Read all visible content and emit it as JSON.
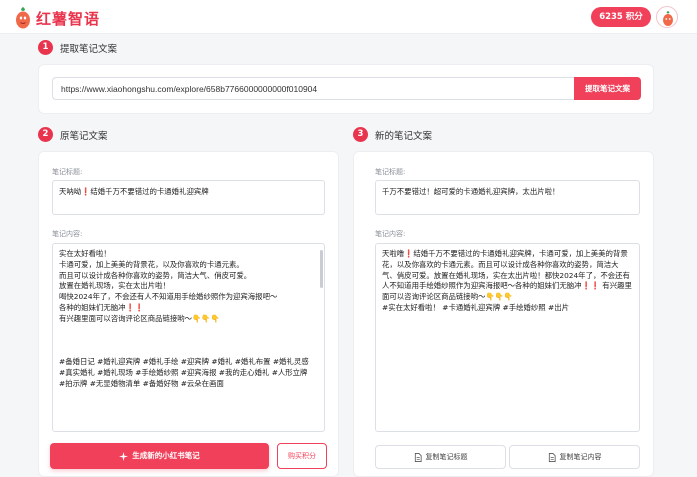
{
  "brand": {
    "name": "红薯智语"
  },
  "header": {
    "points_label": "6235 积分"
  },
  "steps": {
    "s1": {
      "num": "1",
      "label": "提取笔记文案"
    },
    "s2": {
      "num": "2",
      "label": "原笔记文案"
    },
    "s3": {
      "num": "3",
      "label": "新的笔记文案"
    }
  },
  "extract": {
    "url_value": "https://www.xiaohongshu.com/explore/658b7766000000000f010904",
    "button_label": "提取笔记文案"
  },
  "original": {
    "title_label": "笔记标题:",
    "title_value": "天呐呦❗结婚千万不要错过的卡通婚礼迎宾牌",
    "content_label": "笔记内容:",
    "content_lines": [
      "实在太好看啦！",
      "卡通可爱，加上美美的背景花，以及你喜欢的卡通元素。",
      "而且可以设计成各种你喜欢的姿势，简洁大气、俏皮可爱。",
      "放置在婚礼现场，实在太出片啦！",
      "喝快2024年了，不会还有人不知道用手绘婚纱照作为迎宾海报吧～",
      "各种的姐妹们无脑冲❗❗",
      "有兴趣里面可以咨询评论区商品链接哟～👇👇👇",
      "",
      "",
      "#备婚日记 #婚礼迎宾牌 #婚礼手绘 #迎宾牌 #婚礼 #婚礼布置 #婚礼灵感",
      "#真实婚礼 #婚礼现场 #手绘婚纱照 #迎宾海报 #我的走心婚礼 #人形立牌",
      "#拍示牌 #无显婚物清单 #备婚好物 #云朵在画面"
    ],
    "generate_label": "生成新的小红书笔记",
    "buy_label": "购买积分"
  },
  "result": {
    "title_label": "笔记标题:",
    "title_value": "千万不要错过！超可爱的卡通婚礼迎宾牌，太出片啦！",
    "content_label": "笔记内容:",
    "content_text": "天啦噜❗结婚千万不要错过的卡通婚礼迎宾牌，卡通可爱，加上美美的背景花，以及你喜欢的卡通元素。而且可以设计成各种你喜欢的姿势，简洁大气、俏皮可爱。放置在婚礼现场，实在太出片啦！都快2024年了，不会还有人不知道用手绘婚纱照作为迎宾海报吧～各种的姐妹们无脑冲❗❗ 有兴趣里面可以咨询评论区商品链接哟～👇👇👇",
    "content_tags": "#实在太好看啦！ #卡通婚礼迎宾牌 #手绘婚纱照 #出片",
    "copy_title_label": "复制笔记标题",
    "copy_content_label": "复制笔记内容"
  },
  "colors": {
    "accent": "#f0405a",
    "brand": "#e9344d"
  },
  "icons": {
    "logo": "sweet-potato-icon",
    "avatar": "user-avatar",
    "sparkle": "sparkle-icon",
    "copy": "copy-document-icon"
  }
}
